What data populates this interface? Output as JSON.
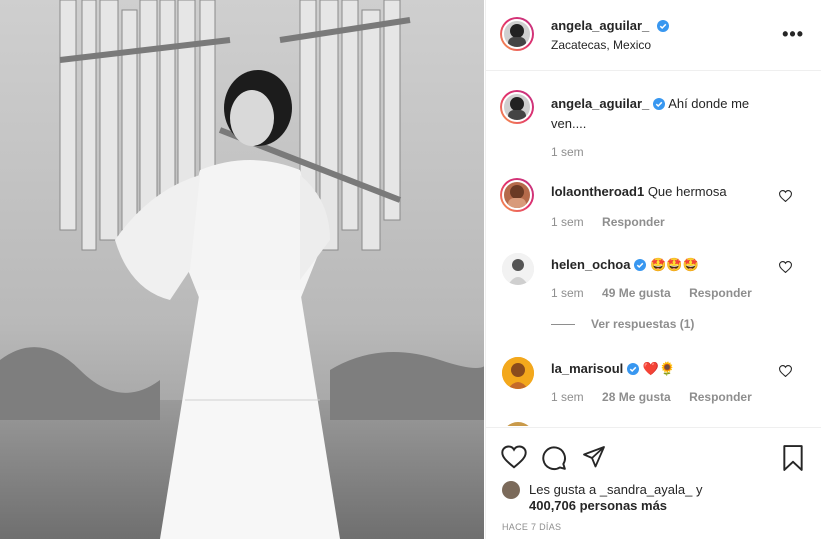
{
  "post": {
    "username": "angela_aguilar_",
    "location": "Zacatecas, Mexico",
    "more_icon": "more-horizontal-icon"
  },
  "caption": {
    "username": "angela_aguilar_",
    "text": "Ahí donde me ven....",
    "time": "1 sem"
  },
  "comments": [
    {
      "username": "lolaontheroad1",
      "text": "Que hermosa",
      "time": "1 sem",
      "likes": "",
      "reply": "Responder",
      "verified": false
    },
    {
      "username": "helen_ochoa",
      "text": "🤩🤩🤩",
      "time": "1 sem",
      "likes": "49 Me gusta",
      "reply": "Responder",
      "verified": true
    },
    {
      "username": "la_marisoul",
      "text": "❤️🌻",
      "time": "1 sem",
      "likes": "28 Me gusta",
      "reply": "Responder",
      "verified": true
    }
  ],
  "view_replies": "Ver respuestas (1)",
  "likes_line1": "Les gusta a _sandra_ayala_ y",
  "likes_line2": "400,706 personas más",
  "post_time": "HACE 7 DÍAS",
  "colors": {
    "verified": "#3897f0",
    "meta": "#8e8e8e",
    "text": "#262626"
  }
}
